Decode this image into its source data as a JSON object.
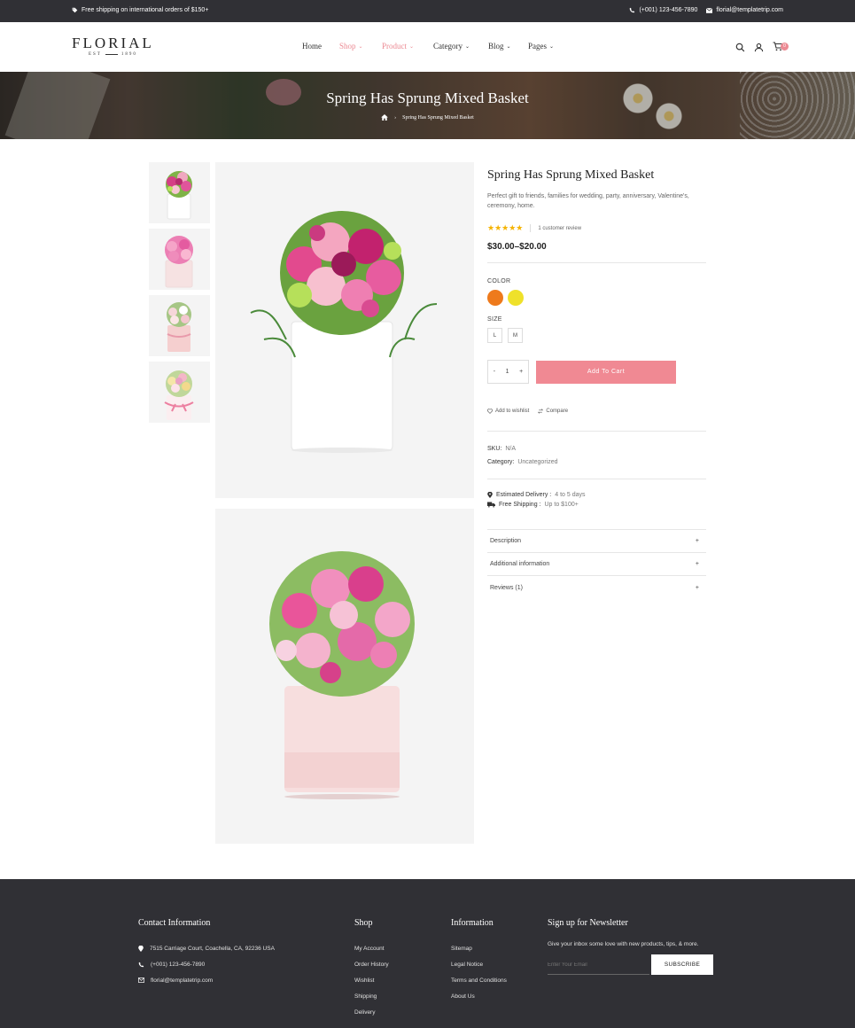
{
  "topbar": {
    "promo": "Free shipping on international orders of $150+",
    "phone": "(+001) 123-456-7890",
    "email": "florial@templatetrip.com"
  },
  "header": {
    "logo_name": "FLORIAL",
    "logo_est": "EST",
    "logo_year": "1890",
    "nav": [
      {
        "label": "Home",
        "active": false,
        "dropdown": false
      },
      {
        "label": "Shop",
        "active": true,
        "dropdown": true
      },
      {
        "label": "Product",
        "active": true,
        "dropdown": true
      },
      {
        "label": "Category",
        "active": false,
        "dropdown": true
      },
      {
        "label": "Blog",
        "active": false,
        "dropdown": true
      },
      {
        "label": "Pages",
        "active": false,
        "dropdown": true
      }
    ],
    "cart_count": "0"
  },
  "banner": {
    "title": "Spring Has Sprung Mixed Basket",
    "breadcrumb_current": "Spring Has Sprung Mixed Basket"
  },
  "product": {
    "title": "Spring Has Sprung Mixed Basket",
    "description": "Perfect gift to friends, families for wedding, party, anniversary, Valentine's, ceremony, home.",
    "rating": 5,
    "stars": "★★★★★",
    "review_text": "1 customer review",
    "price": "$30.00–$20.00",
    "color_label": "COLOR",
    "colors": [
      "#ee7a1c",
      "#efe12a"
    ],
    "size_label": "SIZE",
    "sizes": [
      "L",
      "M"
    ],
    "qty_minus": "-",
    "qty_value": "1",
    "qty_plus": "+",
    "add_to_cart": "Add To Cart",
    "wishlist": "Add to wishlist",
    "compare": "Compare",
    "sku_label": "SKU:",
    "sku_value": "N/A",
    "category_label": "Category:",
    "category_value": "Uncategorized",
    "delivery_label": "Estimated Delivery :",
    "delivery_value": "4 to 5 days",
    "shipping_label": "Free Shipping :",
    "shipping_value": "Up to $100+",
    "accordion": [
      {
        "label": "Description",
        "icon": "+"
      },
      {
        "label": "Additional information",
        "icon": "+"
      },
      {
        "label": "Reviews (1)",
        "icon": "+"
      }
    ]
  },
  "footer": {
    "contact_title": "Contact Information",
    "address": "7515 Carriage Court, Coachella, CA, 92236 USA",
    "phone": "(+001) 123-456-7890",
    "email": "florial@templatetrip.com",
    "shop_title": "Shop",
    "shop_links": [
      "My Account",
      "Order History",
      "Wishlist",
      "Shipping",
      "Delivery"
    ],
    "info_title": "Information",
    "info_links": [
      "Sitemap",
      "Legal Notice",
      "Terms and Conditions",
      "About Us"
    ],
    "newsletter_title": "Sign up for Newsletter",
    "newsletter_text": "Give your inbox some love with new products, tips, & more.",
    "email_placeholder": "Enter Your Email",
    "subscribe_label": "SUBSCRIBE"
  },
  "colors": {
    "accent": "#f08993",
    "dark": "#303035",
    "star": "#f5b301"
  }
}
